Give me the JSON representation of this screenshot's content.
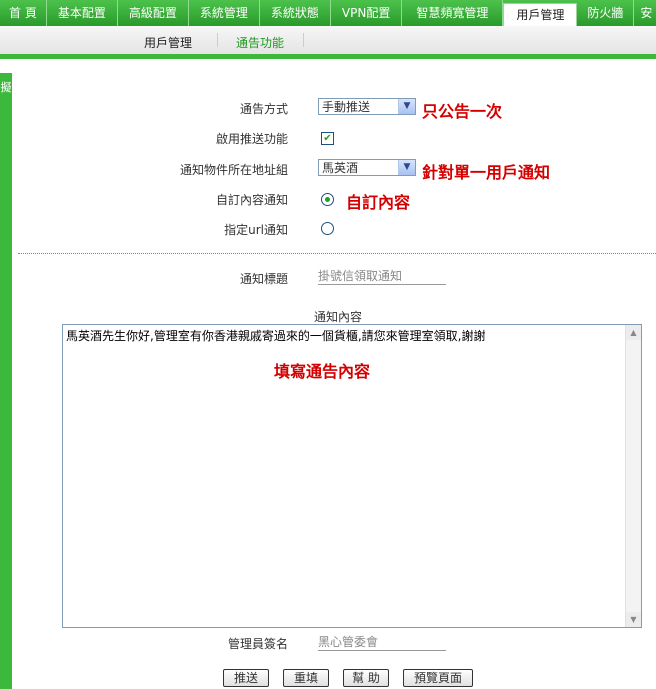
{
  "topnav": {
    "tabs": [
      {
        "label": "首 頁",
        "active": false
      },
      {
        "label": "基本配置",
        "active": false
      },
      {
        "label": "高級配置",
        "active": false
      },
      {
        "label": "系統管理",
        "active": false
      },
      {
        "label": "系統狀態",
        "active": false
      },
      {
        "label": "VPN配置",
        "active": false
      },
      {
        "label": "智慧頻寬管理",
        "active": false
      },
      {
        "label": "用戶管理",
        "active": true
      },
      {
        "label": "防火牆",
        "active": false
      },
      {
        "label": "安",
        "active": false
      }
    ]
  },
  "subnav": {
    "items": [
      {
        "label": "用戶管理",
        "active": false
      },
      {
        "label": "通告功能",
        "active": true
      }
    ]
  },
  "leftbar": {
    "label": "擬"
  },
  "form": {
    "notify_mode_label": "通告方式",
    "notify_mode_value": "手動推送",
    "enable_push_label": "啟用推送功能",
    "enable_push_checked": true,
    "target_group_label": "通知物件所在地址組",
    "target_group_value": "馬英酒",
    "custom_content_label": "自訂內容通知",
    "custom_content_selected": true,
    "url_notify_label": "指定url通知",
    "url_notify_selected": false,
    "title_label": "通知標題",
    "title_value": "掛號信領取通知",
    "content_label": "通知內容",
    "content_value": "馬英酒先生你好,管理室有你香港親戚寄過來的一個貨櫃,請您來管理室領取,謝謝",
    "signature_label": "管理員簽名",
    "signature_value": "黑心管委會"
  },
  "annotations": {
    "once": "只公告一次",
    "single_user": "針對單一用戶通知",
    "custom": "自訂內容",
    "fill_content": "填寫通告內容"
  },
  "buttons": {
    "push": "推送",
    "reset": "重填",
    "help": "幫 助",
    "preview": "預覽頁面"
  },
  "colors": {
    "nav_green": "#3cb83c",
    "annotation_red": "#d40000"
  }
}
